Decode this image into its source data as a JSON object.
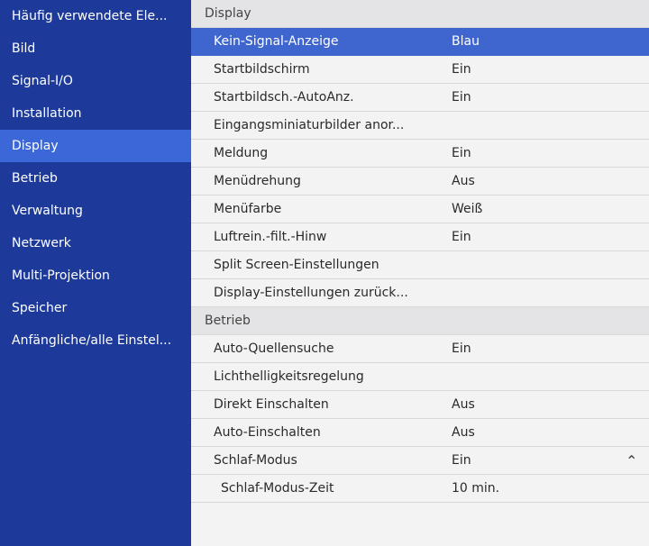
{
  "sidebar": {
    "items": [
      {
        "label": "Häufig verwendete Ele..."
      },
      {
        "label": "Bild"
      },
      {
        "label": "Signal-I/O"
      },
      {
        "label": "Installation"
      },
      {
        "label": "Display"
      },
      {
        "label": "Betrieb"
      },
      {
        "label": "Verwaltung"
      },
      {
        "label": "Netzwerk"
      },
      {
        "label": "Multi-Projektion"
      },
      {
        "label": "Speicher"
      },
      {
        "label": "Anfängliche/alle Einstel..."
      }
    ]
  },
  "main": {
    "sections": [
      {
        "title": "Display",
        "rows": [
          {
            "label": "Kein-Signal-Anzeige",
            "value": "Blau"
          },
          {
            "label": "Startbildschirm",
            "value": "Ein"
          },
          {
            "label": "Startbildsch.-AutoAnz.",
            "value": "Ein"
          },
          {
            "label": "Eingangsminiaturbilder anor...",
            "value": ""
          },
          {
            "label": "Meldung",
            "value": "Ein"
          },
          {
            "label": "Menüdrehung",
            "value": "Aus"
          },
          {
            "label": "Menüfarbe",
            "value": "Weiß"
          },
          {
            "label": "Luftrein.-filt.-Hinw",
            "value": "Ein"
          },
          {
            "label": "Split Screen-Einstellungen",
            "value": ""
          },
          {
            "label": "Display-Einstellungen zurück...",
            "value": ""
          }
        ]
      },
      {
        "title": "Betrieb",
        "rows": [
          {
            "label": "Auto-Quellensuche",
            "value": "Ein"
          },
          {
            "label": "Lichthelligkeitsregelung",
            "value": ""
          },
          {
            "label": "Direkt Einschalten",
            "value": "Aus"
          },
          {
            "label": "Auto-Einschalten",
            "value": "Aus"
          },
          {
            "label": "Schlaf-Modus",
            "value": "Ein",
            "icon": "chevron-up-icon"
          },
          {
            "label": "Schlaf-Modus-Zeit",
            "value": "10 min."
          }
        ]
      }
    ]
  },
  "state": {
    "active_sidebar": "Display",
    "selected_row": "Kein-Signal-Anzeige"
  },
  "colors": {
    "sidebar_bg": "#1d3a9b",
    "sidebar_active": "#3c67d8",
    "row_selected": "#3f66cf",
    "panel_bg": "#f3f3f4"
  }
}
